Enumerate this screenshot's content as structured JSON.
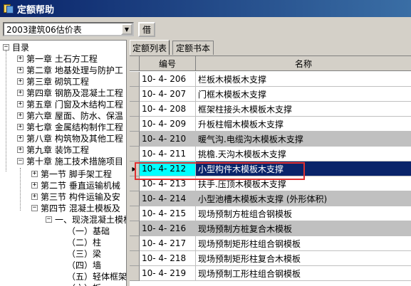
{
  "window": {
    "title": "定额帮助"
  },
  "toolbar": {
    "combo_value": "2003建筑06估价表",
    "jie_button": "借"
  },
  "tree": {
    "root": "目录",
    "chapters": [
      "第一章  土石方工程",
      "第二章  地基处理与防护工",
      "第三章  砌筑工程",
      "第四章  钢筋及混凝土工程",
      "第五章  门窗及木结构工程",
      "第六章  屋面、防水、保温",
      "第七章  金属结构制作工程",
      "第八章  构筑物及其他工程",
      "第九章  装饰工程",
      "第十章  施工技术措施项目"
    ],
    "sections": [
      "第一节  脚手架工程",
      "第二节  垂直运输机械",
      "第三节  构件运输及安",
      "第四节  混凝土模板及"
    ],
    "sub": "一、现浇混凝土模板",
    "items": [
      "（一）基础",
      "（二）柱",
      "（三）梁",
      "（四）墙",
      "（五）轻体框架",
      "（六）板"
    ]
  },
  "tabs": [
    "定额列表",
    "定额书本"
  ],
  "grid": {
    "headers": [
      "编号",
      "名称"
    ],
    "rows": [
      {
        "code": "10- 4- 206",
        "name": "栏板木模板木支撑",
        "style": "white"
      },
      {
        "code": "10- 4- 207",
        "name": "门框木模板木支撑",
        "style": "white"
      },
      {
        "code": "10- 4- 208",
        "name": "框架柱接头木模板木支撑",
        "style": "white"
      },
      {
        "code": "10- 4- 209",
        "name": "升板柱帽木模板木支撑",
        "style": "white"
      },
      {
        "code": "10- 4- 210",
        "name": "暖气沟.电缆沟木模板木支撑",
        "style": "gray"
      },
      {
        "code": "10- 4- 211",
        "name": "挑檐.天沟木模板木支撑",
        "style": "white"
      },
      {
        "code": "10- 4- 212",
        "name": "小型构件木模板木支撑",
        "style": "sel"
      },
      {
        "code": "10- 4- 213",
        "name": "扶手.压顶木模板木支撑",
        "style": "white"
      },
      {
        "code": "10- 4- 214",
        "name": "小型池槽木模板木支撑 (外形体积)",
        "style": "gray"
      },
      {
        "code": "10- 4- 215",
        "name": "现场预制方桩组合钢模板",
        "style": "white"
      },
      {
        "code": "10- 4- 216",
        "name": "现场预制方桩复合木模板",
        "style": "gray"
      },
      {
        "code": "10- 4- 217",
        "name": "现场预制矩形柱组合钢模板",
        "style": "white"
      },
      {
        "code": "10- 4- 218",
        "name": "现场预制矩形柱复合木模板",
        "style": "white"
      },
      {
        "code": "10- 4- 219",
        "name": "现场预制工形柱组合钢模板",
        "style": "white"
      }
    ]
  }
}
